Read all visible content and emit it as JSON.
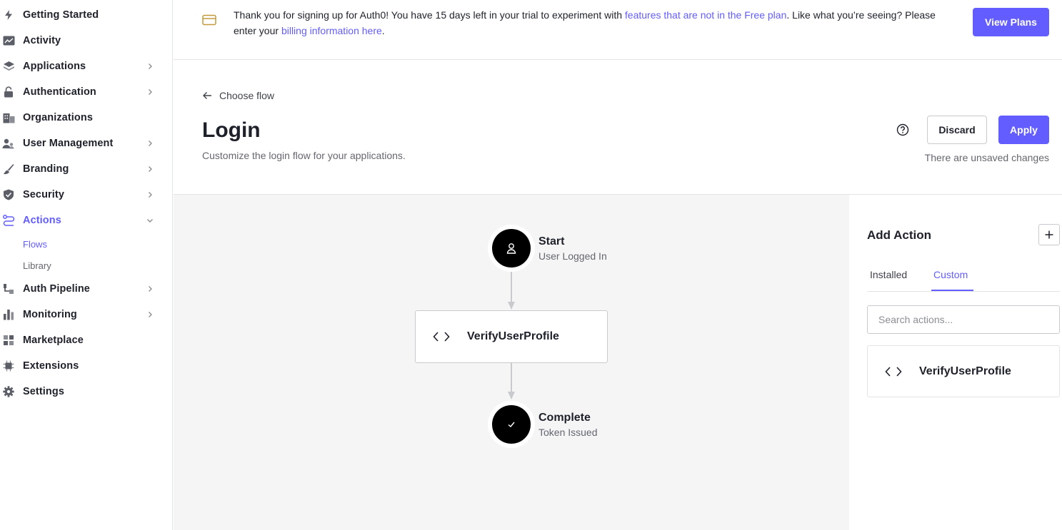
{
  "sidebar": {
    "items": [
      {
        "label": "Getting Started",
        "icon": "bolt-icon"
      },
      {
        "label": "Activity",
        "icon": "chart-line-icon"
      },
      {
        "label": "Applications",
        "icon": "layers-icon"
      },
      {
        "label": "Authentication",
        "icon": "lock-icon"
      },
      {
        "label": "Organizations",
        "icon": "building-icon"
      },
      {
        "label": "User Management",
        "icon": "users-icon"
      },
      {
        "label": "Branding",
        "icon": "brush-icon"
      },
      {
        "label": "Security",
        "icon": "shield-icon"
      },
      {
        "label": "Actions",
        "icon": "actions-icon"
      },
      {
        "label": "Auth Pipeline",
        "icon": "pipeline-icon"
      },
      {
        "label": "Monitoring",
        "icon": "bar-chart-icon"
      },
      {
        "label": "Marketplace",
        "icon": "grid-icon"
      },
      {
        "label": "Extensions",
        "icon": "chip-icon"
      },
      {
        "label": "Settings",
        "icon": "gear-icon"
      }
    ],
    "sub_items": [
      {
        "label": "Flows"
      },
      {
        "label": "Library"
      }
    ]
  },
  "banner": {
    "text_1": "Thank you for signing up for Auth0! You have 15 days left in your trial to experiment with ",
    "link_1": "features that are not in the Free plan",
    "text_2": ". Like what you’re seeing? Please enter your ",
    "link_2": "billing information here",
    "text_3": ".",
    "button": "View Plans"
  },
  "header": {
    "back_label": "Choose flow",
    "title": "Login",
    "subtitle": "Customize the login flow for your applications.",
    "discard": "Discard",
    "apply": "Apply",
    "unsaved": "There are unsaved changes"
  },
  "flow": {
    "start_title": "Start",
    "start_sub": "User Logged In",
    "action_name": "VerifyUserProfile",
    "complete_title": "Complete",
    "complete_sub": "Token Issued"
  },
  "panel": {
    "title": "Add Action",
    "tabs": [
      {
        "label": "Installed"
      },
      {
        "label": "Custom"
      }
    ],
    "search_placeholder": "Search actions...",
    "actions": [
      {
        "name": "VerifyUserProfile"
      }
    ]
  },
  "colors": {
    "accent": "#635dff",
    "canvas": "#f5f5f6",
    "text": "#1e212a",
    "muted": "#65676e"
  }
}
